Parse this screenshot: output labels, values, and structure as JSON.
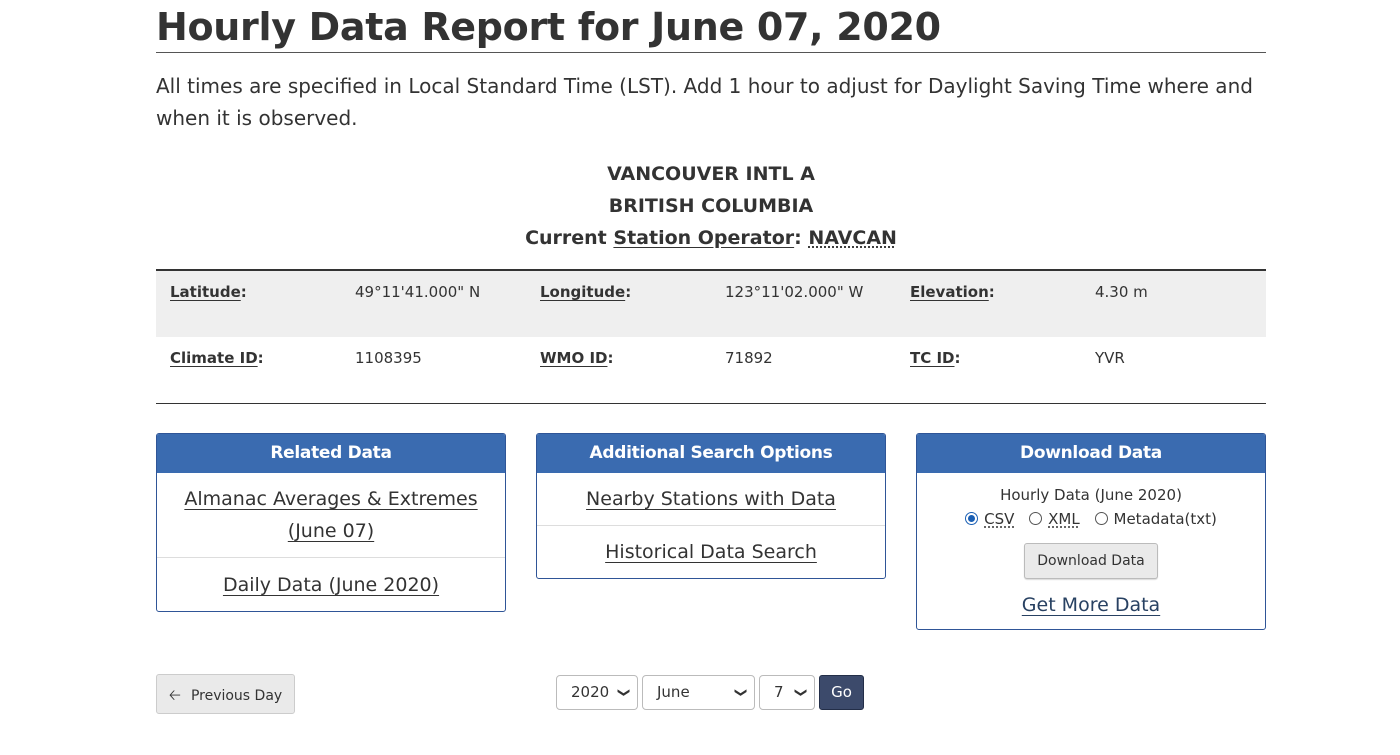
{
  "page": {
    "title": "Hourly Data Report for June 07, 2020",
    "intro": "All times are specified in Local Standard Time (LST). Add 1 hour to adjust for Daylight Saving Time where and when it is observed."
  },
  "station": {
    "name": "VANCOUVER INTL A",
    "province": "BRITISH COLUMBIA",
    "operator_prefix": "Current",
    "operator_label": "Station Operator",
    "operator_colon": ":",
    "operator_value": "NAVCAN"
  },
  "metadata": {
    "row1": [
      {
        "label": "Latitude",
        "value": "49°11'41.000\" N"
      },
      {
        "label": "Longitude",
        "value": "123°11'02.000\" W"
      },
      {
        "label": "Elevation",
        "value": "4.30 m"
      }
    ],
    "row2": [
      {
        "label": "Climate ID",
        "value": "1108395"
      },
      {
        "label": "WMO ID",
        "value": "71892"
      },
      {
        "label": "TC ID",
        "value": "YVR"
      }
    ],
    "colon": ":"
  },
  "related": {
    "heading": "Related Data",
    "links": [
      "Almanac Averages & Extremes (June 07)",
      "Daily Data (June 2020)"
    ]
  },
  "search": {
    "heading": "Additional Search Options",
    "links": [
      "Nearby Stations with Data",
      "Historical Data Search"
    ]
  },
  "download": {
    "heading": "Download Data",
    "caption": "Hourly Data (June 2020)",
    "formats": [
      "CSV",
      "XML",
      "Metadata(txt)"
    ],
    "selected_format": "CSV",
    "button_label": "Download Data",
    "more_link": "Get More Data"
  },
  "nav": {
    "prev_label": "Previous Day",
    "year": "2020",
    "month": "June",
    "day": "7",
    "go_label": "Go"
  },
  "colors": {
    "panel_header": "#3a6bb0",
    "go_button": "#3c4a6b",
    "link": "#284162"
  }
}
